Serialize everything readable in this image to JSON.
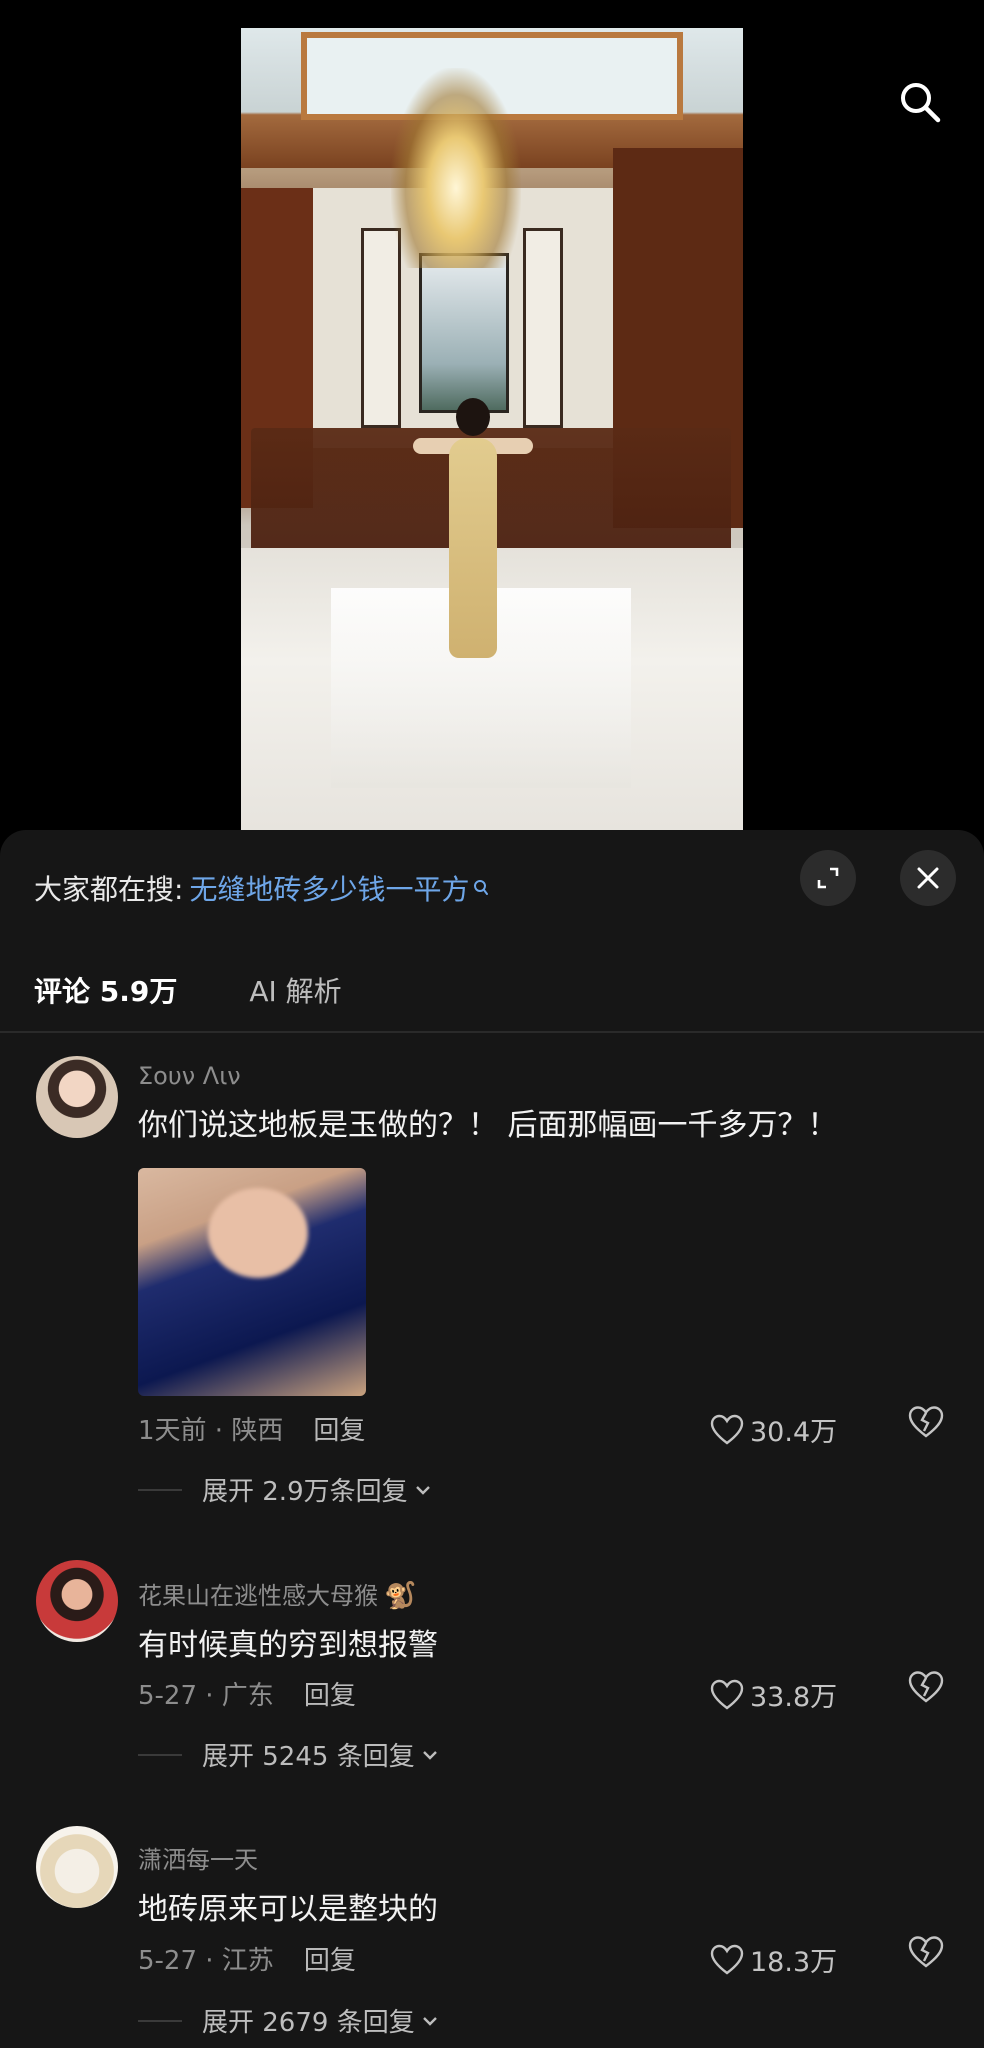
{
  "hot_search": {
    "prefix": "大家都在搜:",
    "term": "无缝地砖多少钱一平方"
  },
  "tabs": [
    {
      "label": "评论 5.9万"
    },
    {
      "label": "AI 解析"
    }
  ],
  "comments": [
    {
      "username": "Σουν Λιν",
      "text": "你们说这地板是玉做的？！ 后面那幅画一千多万？！",
      "meta": "1天前 · 陕西",
      "reply": "回复",
      "likes": "30.4万",
      "expand": "展开 2.9万条回复"
    },
    {
      "username": "花果山在逃性感大母猴",
      "emoji": "🐒",
      "text": "有时候真的穷到想报警",
      "meta": "5-27 · 广东",
      "reply": "回复",
      "likes": "33.8万",
      "expand": "展开 5245 条回复"
    },
    {
      "username": "潇洒每一天",
      "text": "地砖原来可以是整块的",
      "meta": "5-27 · 江苏",
      "reply": "回复",
      "likes": "18.3万",
      "expand": "展开 2679 条回复"
    }
  ],
  "colors": {
    "sheet_bg": "#161616",
    "link_blue": "#6ea6e8",
    "muted": "#8d8d8d"
  },
  "icons": [
    "search-icon",
    "expand-icon",
    "close-icon",
    "heart-icon",
    "broken-heart-icon",
    "chevron-down-icon"
  ]
}
